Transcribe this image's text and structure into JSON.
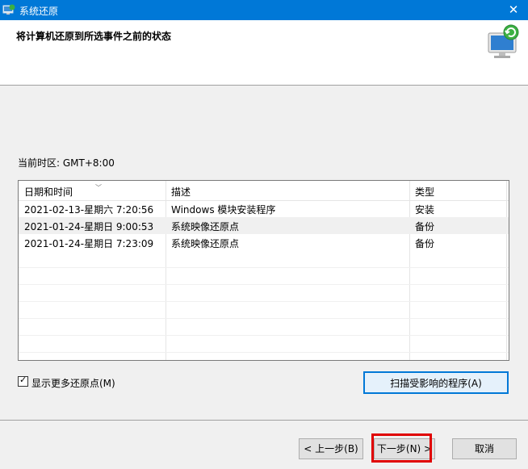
{
  "window": {
    "title": "系统还原",
    "close_glyph": "✕",
    "app_icon": "system-restore-icon"
  },
  "header": {
    "title": "将计算机还原到所选事件之前的状态",
    "icon": "restore-computer-icon"
  },
  "timezone_label": "当前时区: GMT+8:00",
  "table": {
    "columns": [
      "日期和时间",
      "描述",
      "类型"
    ],
    "rows": [
      {
        "datetime": "2021-02-13-星期六 7:20:56",
        "description": "Windows 模块安装程序",
        "type": "安装"
      },
      {
        "datetime": "2021-01-24-星期日 9:00:53",
        "description": "系统映像还原点",
        "type": "备份"
      },
      {
        "datetime": "2021-01-24-星期日 7:23:09",
        "description": "系统映像还原点",
        "type": "备份"
      }
    ]
  },
  "show_more_checkbox": {
    "label": "显示更多还原点(M)",
    "checked": true
  },
  "scan_button": "扫描受影响的程序(A)",
  "buttons": {
    "back": "< 上一步(B)",
    "next": "下一步(N) >",
    "cancel": "取消"
  },
  "colors": {
    "titlebar": "#0078d7",
    "highlight": "#e00000",
    "scan_border": "#0078d7"
  }
}
